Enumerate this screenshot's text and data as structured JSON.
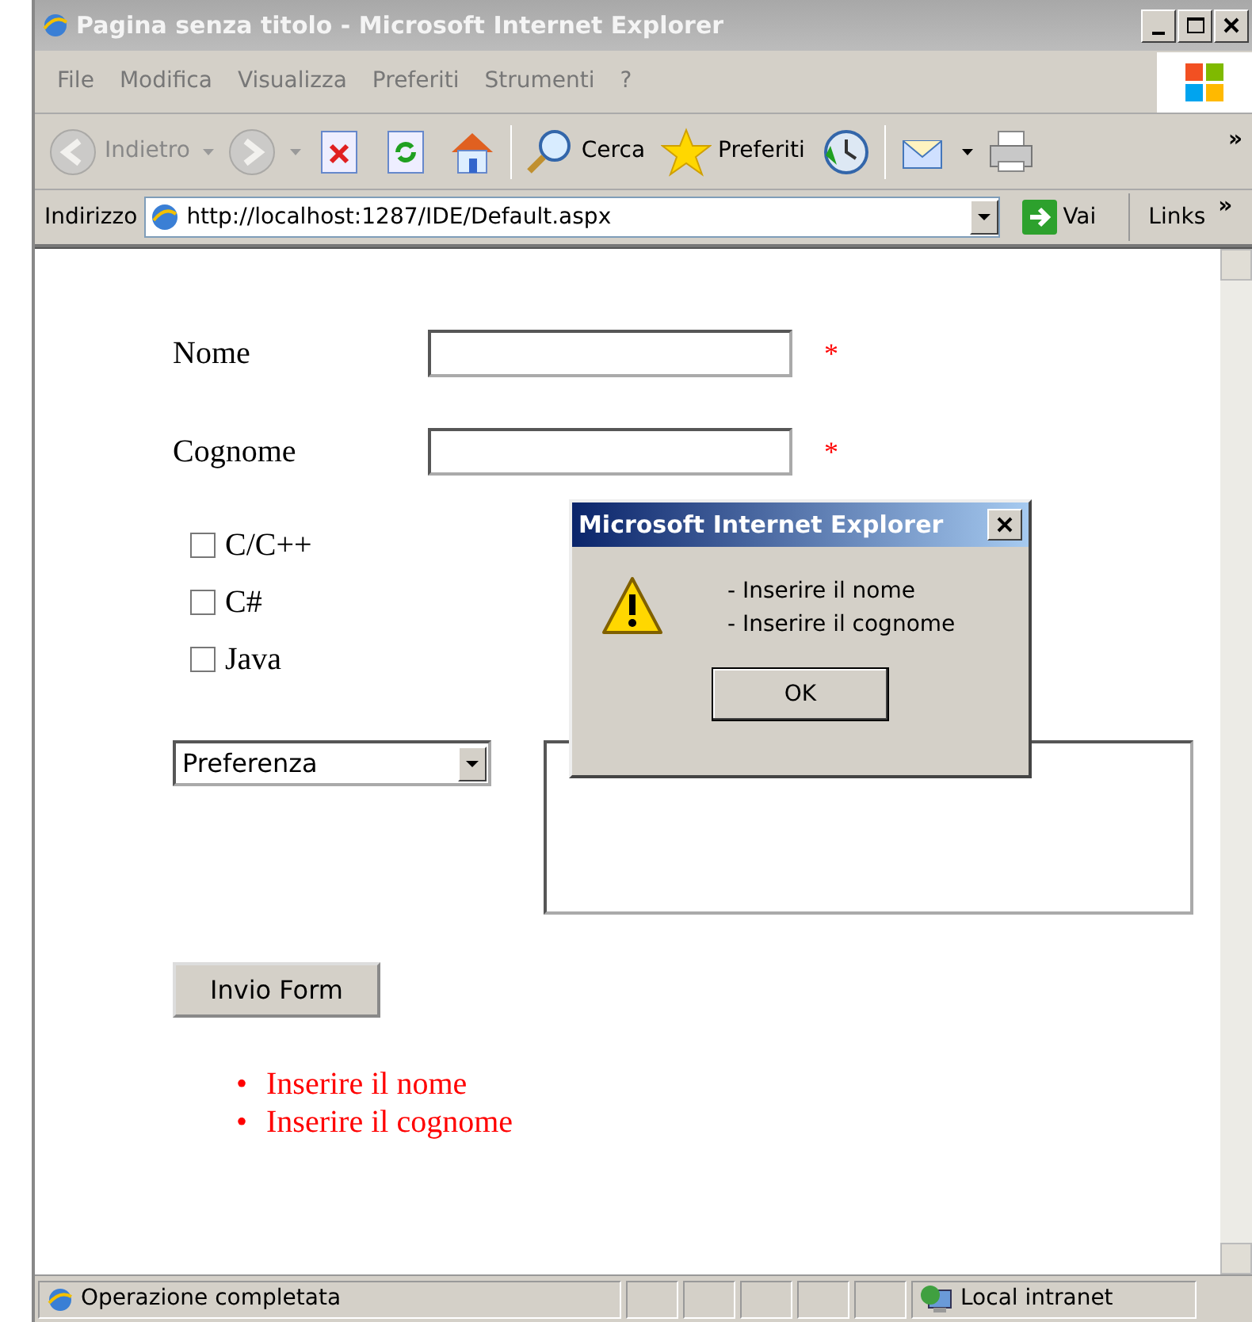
{
  "window": {
    "title": "Pagina senza titolo - Microsoft Internet Explorer"
  },
  "menu": [
    "File",
    "Modifica",
    "Visualizza",
    "Preferiti",
    "Strumenti",
    "?"
  ],
  "toolbar": [
    {
      "kind": "back",
      "label": "Indietro",
      "disabled": true
    },
    {
      "kind": "forward",
      "disabled": true
    },
    {
      "kind": "stop",
      "disabled": false
    },
    {
      "kind": "refresh",
      "disabled": false
    },
    {
      "kind": "home",
      "disabled": false
    },
    {
      "kind": "search",
      "label": "Cerca",
      "disabled": false
    },
    {
      "kind": "favorites",
      "label": "Preferiti",
      "disabled": false
    },
    {
      "kind": "history",
      "disabled": false
    },
    {
      "kind": "mail",
      "disabled": false
    },
    {
      "kind": "print",
      "disabled": false
    }
  ],
  "toolbar_more": "»",
  "address": {
    "label": "Indirizzo",
    "url": "http://localhost:1287/IDE/Default.aspx",
    "go": "Vai",
    "links": "Links",
    "links_more": "»"
  },
  "form": {
    "fields": [
      {
        "label": "Nome",
        "required_mark": "*"
      },
      {
        "label": "Cognome",
        "required_mark": "*"
      }
    ],
    "checkboxes": [
      {
        "label": "C/C++",
        "checked": false
      },
      {
        "label": "C#",
        "checked": false
      },
      {
        "label": "Java",
        "checked": false
      }
    ],
    "select": "Preferenza",
    "submit": "Invio Form",
    "errors": [
      {
        "bullet": "•",
        "text": "Inserire il nome"
      },
      {
        "bullet": "•",
        "text": "Inserire il cognome"
      }
    ]
  },
  "dialog": {
    "title": "Microsoft Internet Explorer",
    "lines": [
      "- Inserire il nome",
      "- Inserire il cognome"
    ],
    "button": "OK"
  },
  "status_bar": {
    "text": "Operazione completata",
    "zone": "Local intranet"
  }
}
